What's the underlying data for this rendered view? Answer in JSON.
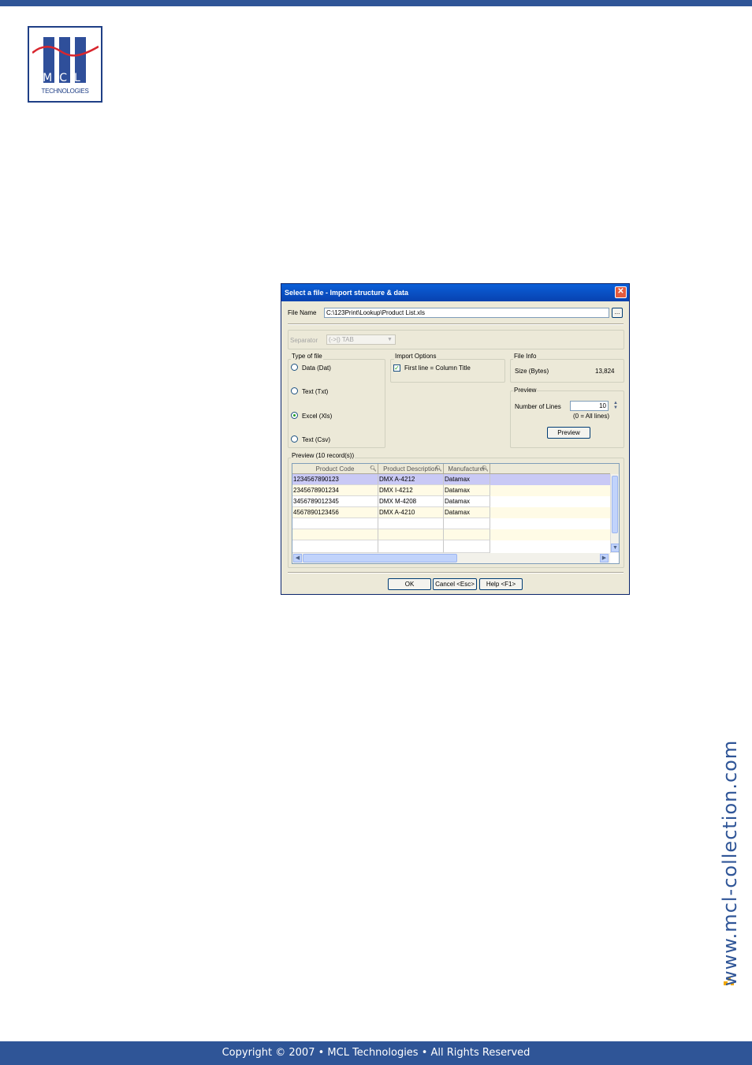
{
  "logo": {
    "letters": "MCL",
    "company": "TECHNOLOGIES"
  },
  "side_url": "www.mcl-collection.com",
  "footer": "Copyright © 2007 • MCL Technologies • All Rights Reserved",
  "colors": {
    "brand_blue": "#2f5597",
    "title_blue": "#0a5fd8",
    "row_selected": "#c9c9f5",
    "row_alt": "#fffbe6"
  },
  "dialog": {
    "title": "Select a file - Import structure & data",
    "close_label": "✕",
    "file_name_label": "File Name",
    "file_name_value": "C:\\123Print\\Lookup\\Product List.xls",
    "browse_label": "...",
    "separator_label": "Separator",
    "separator_value": "(->|) TAB",
    "type_of_file": {
      "legend": "Type of file",
      "options": [
        "Data (Dat)",
        "Text (Txt)",
        "Excel (Xls)",
        "Text (Csv)"
      ],
      "selected": "Excel (Xls)"
    },
    "import_options": {
      "legend": "Import Options",
      "first_line_label": "First line = Column Title",
      "first_line_checked": true
    },
    "file_info": {
      "legend": "File Info",
      "size_label": "Size (Bytes)",
      "size_value": "13,824"
    },
    "preview": {
      "legend": "Preview",
      "lines_label": "Number of Lines",
      "lines_value": "10",
      "lines_hint": "(0 = All lines)",
      "preview_button": "Preview"
    },
    "grid": {
      "legend": "Preview (10 record(s))",
      "columns": [
        "Product Code",
        "Product Description",
        "Manufacturer"
      ],
      "rows": [
        [
          "1234567890123",
          "DMX A-4212",
          "Datamax"
        ],
        [
          "2345678901234",
          "DMX I-4212",
          "Datamax"
        ],
        [
          "3456789012345",
          "DMX M-4208",
          "Datamax"
        ],
        [
          "4567890123456",
          "DMX A-4210",
          "Datamax"
        ]
      ]
    },
    "buttons": {
      "ok": "OK",
      "cancel": "Cancel <Esc>",
      "help": "Help <F1>"
    }
  }
}
